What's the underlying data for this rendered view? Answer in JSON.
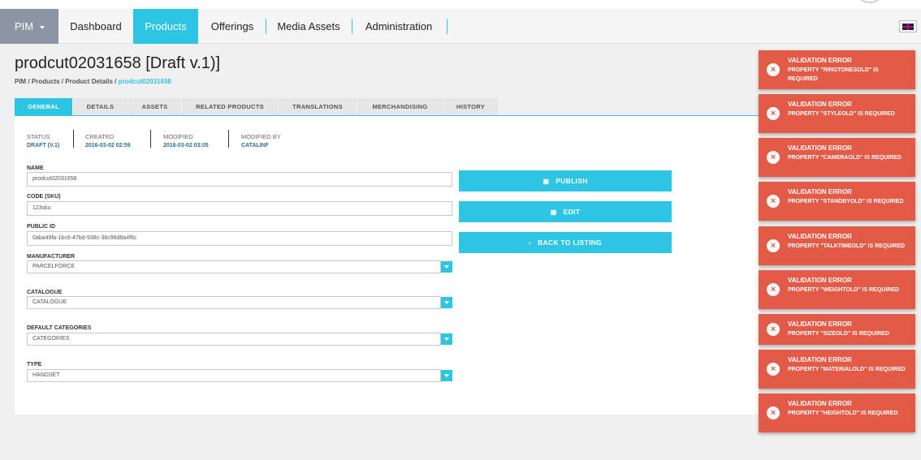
{
  "nav": {
    "app_label": "PIM",
    "items": [
      "Dashboard",
      "Products",
      "Offerings",
      "Media Assets",
      "Administration"
    ],
    "active": "Products",
    "language_icon": "uk-flag-icon"
  },
  "page": {
    "title": "prodcut02031658 [Draft v.1)]",
    "breadcrumb": [
      "PIM",
      "Products",
      "Product Details",
      "prodcut02031658"
    ]
  },
  "tabs": [
    "GENERAL",
    "DETAILS",
    "ASSETS",
    "RELATED PRODUCTS",
    "TRANSLATIONS",
    "MERCHANDISING",
    "HISTORY"
  ],
  "meta": {
    "status_label": "STATUS",
    "status_value": "DRAFT (V.1)",
    "created_label": "CREATED",
    "created_value": "2016-03-02 02:59",
    "modified_label": "MODIFIED",
    "modified_value": "2016-03-02 03:05",
    "modified_by_label": "MODIFIED BY",
    "modified_by_value": "CATALINF"
  },
  "form": {
    "name_label": "NAME",
    "name_value": "prodcut02031658",
    "code_label": "CODE (SKU)",
    "code_value": "123sku",
    "public_id_label": "PUBLIC ID",
    "public_id_value": "0aba49fa-1bc6-47bd-938c-36c96d8a4f6c",
    "manufacturer_label": "MANUFACTURER",
    "manufacturer_value": "PARCELFORCE",
    "catalogue_label": "CATALOGUE",
    "catalogue_value": "CATALOGUE",
    "categories_label": "DEFAULT CATEGORIES",
    "categories_value": "CATEGORIES",
    "type_label": "TYPE",
    "type_value": "HANDSET"
  },
  "actions": {
    "publish": "PUBLISH",
    "edit": "EDIT",
    "back": "BACK TO LISTING"
  },
  "toasts": [
    {
      "title": "VALIDATION ERROR",
      "message": "PROPERTY \"RINGTONESOLD\" IS REQUIRED"
    },
    {
      "title": "VALIDATION ERROR",
      "message": "PROPERTY \"STYLEOLD\" IS REQUIRED"
    },
    {
      "title": "VALIDATION ERROR",
      "message": "PROPERTY \"CAMERAOLD\" IS REQUIRED"
    },
    {
      "title": "VALIDATION ERROR",
      "message": "PROPERTY \"STANDBYOLD\" IS REQUIRED"
    },
    {
      "title": "VALIDATION ERROR",
      "message": "PROPERTY \"TALKTIMEOLD\" IS REQUIRED"
    },
    {
      "title": "VALIDATION ERROR",
      "message": "PROPERTY \"WEIGHTOLD\" IS REQUIRED"
    },
    {
      "title": "VALIDATION ERROR",
      "message": "PROPERTY \"SIZEOLD\" IS REQUIRED"
    },
    {
      "title": "VALIDATION ERROR",
      "message": "PROPERTY \"MATERIALOLD\" IS REQUIRED"
    },
    {
      "title": "VALIDATION ERROR",
      "message": "PROPERTY \"HEIGHTOLD\" IS REQUIRED"
    }
  ],
  "colors": {
    "accent": "#2ec4e4",
    "error": "#e35b46",
    "app_button": "#8b95a3"
  }
}
